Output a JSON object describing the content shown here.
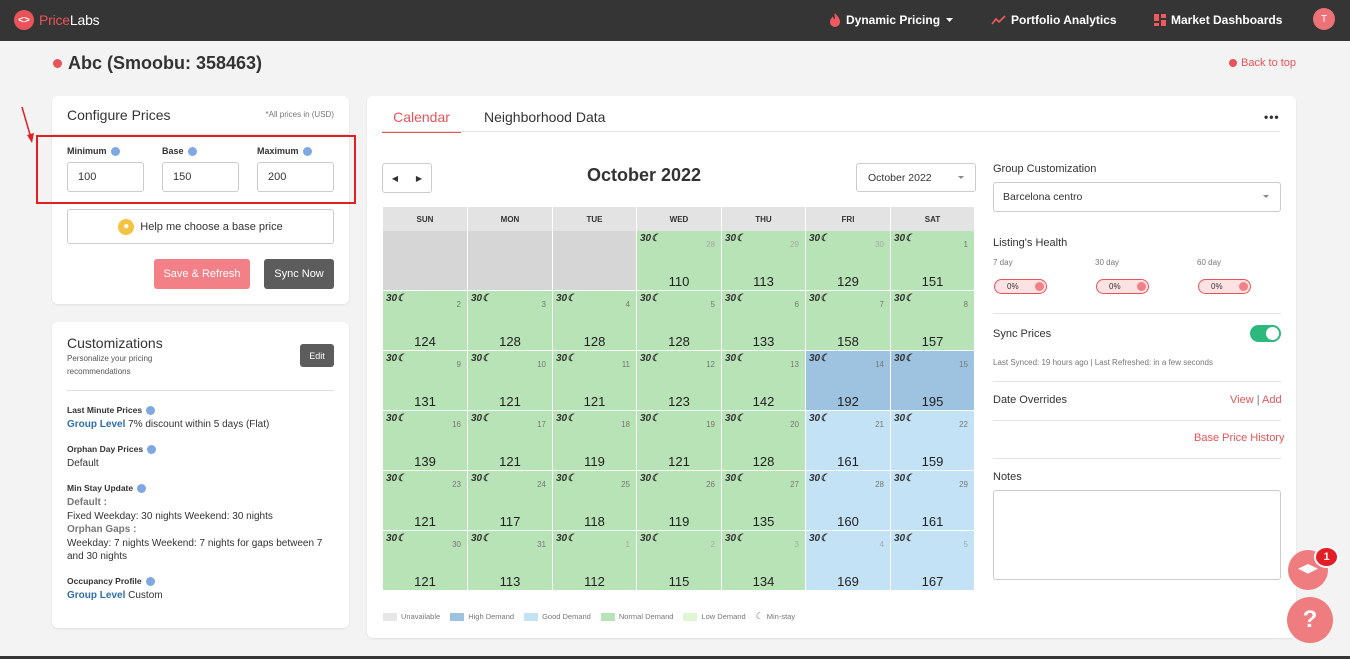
{
  "colors": {
    "brand_red": "#e8545a",
    "nav_bg": "#353535",
    "unavailable": "#d6d6d6",
    "high": "#9dc3e0",
    "good": "#c3e2f6",
    "normal": "#b8e3b6",
    "low": "#dff5d3",
    "sync_green": "#2db87d"
  },
  "topbar": {
    "logo_part1": "Price",
    "logo_part2": "Labs",
    "nav": [
      {
        "label": "Dynamic Pricing",
        "icon": "flame-icon"
      },
      {
        "label": "Portfolio Analytics",
        "icon": "trend-icon"
      },
      {
        "label": "Market Dashboards",
        "icon": "dashboard-icon"
      }
    ],
    "avatar": "T"
  },
  "page": {
    "title": "Abc (Smoobu: 358463)",
    "back_to_top": "Back to top"
  },
  "configure": {
    "title": "Configure Prices",
    "note": "*All prices in (USD)",
    "minimum_label": "Minimum",
    "minimum_value": "100",
    "base_label": "Base",
    "base_value": "150",
    "maximum_label": "Maximum",
    "maximum_value": "200",
    "help_label": "Help me choose a base price",
    "save_label": "Save & Refresh",
    "sync_label": "Sync Now"
  },
  "customizations": {
    "title": "Customizations",
    "subtitle": "Personalize your pricing recommendations",
    "edit_label": "Edit",
    "last_minute_label": "Last Minute Prices",
    "last_minute_group": "Group Level",
    "last_minute_text": " 7% discount within 5 days (Flat)",
    "orphan_label": "Orphan Day Prices",
    "orphan_value": "Default",
    "minstay_label": "Min Stay Update",
    "minstay_default_heading": "Default :",
    "minstay_default_text": "Fixed Weekday: 30 nights Weekend: 30 nights",
    "minstay_orphan_heading": "Orphan Gaps :",
    "minstay_orphan_text": "Weekday: 7 nights Weekend: 7 nights for gaps between 7 and 30 nights",
    "occupancy_label": "Occupancy Profile",
    "occupancy_group": "Group Level",
    "occupancy_text": " Custom"
  },
  "calendar": {
    "tab_calendar": "Calendar",
    "tab_neighborhood": "Neighborhood Data",
    "more": "•••",
    "month_title": "October 2022",
    "month_select": "October 2022",
    "weekdays": [
      "SUN",
      "MON",
      "TUE",
      "WED",
      "THU",
      "FRI",
      "SAT"
    ],
    "days": [
      {
        "d": "",
        "p": "",
        "s": "unavailable",
        "ms": ""
      },
      {
        "d": "",
        "p": "",
        "s": "unavailable",
        "ms": ""
      },
      {
        "d": "",
        "p": "",
        "s": "unavailable",
        "ms": ""
      },
      {
        "d": "28",
        "p": "110",
        "s": "normal",
        "ms": "30☾",
        "dim": true
      },
      {
        "d": "29",
        "p": "113",
        "s": "normal",
        "ms": "30☾",
        "dim": true
      },
      {
        "d": "30",
        "p": "129",
        "s": "normal",
        "ms": "30☾",
        "dim": true
      },
      {
        "d": "1",
        "p": "151",
        "s": "normal",
        "ms": "30☾"
      },
      {
        "d": "2",
        "p": "124",
        "s": "normal",
        "ms": "30☾"
      },
      {
        "d": "3",
        "p": "128",
        "s": "normal",
        "ms": "30☾"
      },
      {
        "d": "4",
        "p": "128",
        "s": "normal",
        "ms": "30☾"
      },
      {
        "d": "5",
        "p": "128",
        "s": "normal",
        "ms": "30☾"
      },
      {
        "d": "6",
        "p": "133",
        "s": "normal",
        "ms": "30☾"
      },
      {
        "d": "7",
        "p": "158",
        "s": "normal",
        "ms": "30☾"
      },
      {
        "d": "8",
        "p": "157",
        "s": "normal",
        "ms": "30☾"
      },
      {
        "d": "9",
        "p": "131",
        "s": "normal",
        "ms": "30☾"
      },
      {
        "d": "10",
        "p": "121",
        "s": "normal",
        "ms": "30☾"
      },
      {
        "d": "11",
        "p": "121",
        "s": "normal",
        "ms": "30☾"
      },
      {
        "d": "12",
        "p": "123",
        "s": "normal",
        "ms": "30☾"
      },
      {
        "d": "13",
        "p": "142",
        "s": "normal",
        "ms": "30☾"
      },
      {
        "d": "14",
        "p": "192",
        "s": "high",
        "ms": "30☾"
      },
      {
        "d": "15",
        "p": "195",
        "s": "high",
        "ms": "30☾"
      },
      {
        "d": "16",
        "p": "139",
        "s": "normal",
        "ms": "30☾"
      },
      {
        "d": "17",
        "p": "121",
        "s": "normal",
        "ms": "30☾"
      },
      {
        "d": "18",
        "p": "119",
        "s": "normal",
        "ms": "30☾"
      },
      {
        "d": "19",
        "p": "121",
        "s": "normal",
        "ms": "30☾"
      },
      {
        "d": "20",
        "p": "128",
        "s": "normal",
        "ms": "30☾"
      },
      {
        "d": "21",
        "p": "161",
        "s": "good",
        "ms": "30☾"
      },
      {
        "d": "22",
        "p": "159",
        "s": "good",
        "ms": "30☾"
      },
      {
        "d": "23",
        "p": "121",
        "s": "normal",
        "ms": "30☾"
      },
      {
        "d": "24",
        "p": "117",
        "s": "normal",
        "ms": "30☾"
      },
      {
        "d": "25",
        "p": "118",
        "s": "normal",
        "ms": "30☾"
      },
      {
        "d": "26",
        "p": "119",
        "s": "normal",
        "ms": "30☾"
      },
      {
        "d": "27",
        "p": "135",
        "s": "normal",
        "ms": "30☾"
      },
      {
        "d": "28",
        "p": "160",
        "s": "good",
        "ms": "30☾"
      },
      {
        "d": "29",
        "p": "161",
        "s": "good",
        "ms": "30☾"
      },
      {
        "d": "30",
        "p": "121",
        "s": "normal",
        "ms": "30☾"
      },
      {
        "d": "31",
        "p": "113",
        "s": "normal",
        "ms": "30☾"
      },
      {
        "d": "1",
        "p": "112",
        "s": "normal",
        "ms": "30☾",
        "dim": true
      },
      {
        "d": "2",
        "p": "115",
        "s": "normal",
        "ms": "30☾",
        "dim": true
      },
      {
        "d": "3",
        "p": "134",
        "s": "normal",
        "ms": "30☾",
        "dim": true
      },
      {
        "d": "4",
        "p": "169",
        "s": "good",
        "ms": "30☾",
        "dim": true
      },
      {
        "d": "5",
        "p": "167",
        "s": "good",
        "ms": "30☾",
        "dim": true
      }
    ],
    "legend": [
      {
        "label": "Unavailable",
        "color": "#e6e6e6"
      },
      {
        "label": "High Demand",
        "color": "#9dc3e0"
      },
      {
        "label": "Good Demand",
        "color": "#c3e2f6"
      },
      {
        "label": "Normal Demand",
        "color": "#b8e3b6"
      },
      {
        "label": "Low Demand",
        "color": "#dff5d3"
      }
    ],
    "legend_minstay": "Min-stay"
  },
  "right_panel": {
    "group_label": "Group Customization",
    "group_value": "Barcelona centro",
    "health_label": "Listing's Health",
    "h7_label": "7 day",
    "h7_value": "0%",
    "h30_label": "30 day",
    "h30_value": "0%",
    "h60_label": "60 day",
    "h60_value": "0%",
    "sync_label": "Sync Prices",
    "sync_status": "Last Synced: 19 hours ago | Last Refreshed: in a few seconds",
    "overrides_label": "Date Overrides",
    "overrides_view": "View",
    "overrides_sep": "|",
    "overrides_add": "Add",
    "base_history": "Base Price History",
    "notes_label": "Notes"
  },
  "widgets": {
    "badge_count": "1",
    "help_symbol": "?"
  }
}
